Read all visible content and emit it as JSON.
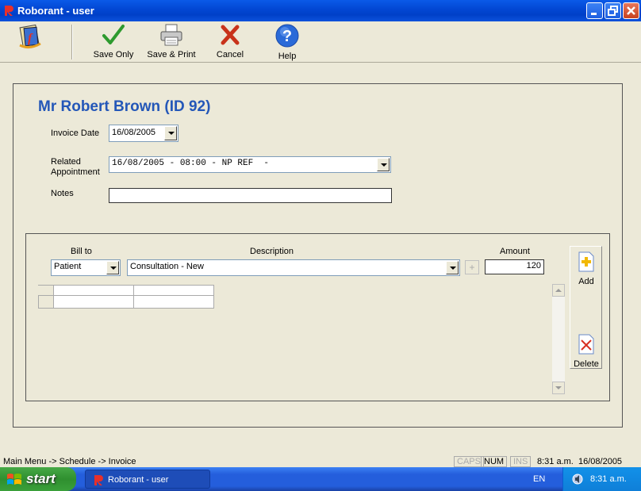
{
  "window": {
    "title": "Roborant - user"
  },
  "toolbar": {
    "save_only": "Save Only",
    "save_print": "Save & Print",
    "cancel": "Cancel",
    "help": "Help"
  },
  "form": {
    "patient_name": "Mr Robert Brown (ID 92)",
    "invoice_date_label": "Invoice Date",
    "invoice_date_value": "16/08/2005",
    "related_label_1": "Related",
    "related_label_2": "Appointment",
    "related_value": "16/08/2005 - 08:00 - NP REF  -",
    "notes_label": "Notes",
    "notes_value": ""
  },
  "line": {
    "bill_to_label": "Bill to",
    "bill_to_value": "Patient",
    "description_label": "Description",
    "description_value": "Consultation - New",
    "amount_label": "Amount",
    "amount_value": "120",
    "plus": "+"
  },
  "side": {
    "add": "Add",
    "delete": "Delete"
  },
  "status": {
    "breadcrumb": "Main Menu -> Schedule -> Invoice",
    "caps": "CAPS",
    "num": "NUM",
    "ins": "INS",
    "time": "8:31 a.m.",
    "date": "16/08/2005"
  },
  "taskbar": {
    "start": "start",
    "task": "Roborant - user",
    "lang": "EN",
    "clock": "8:31 a.m."
  },
  "colors": {
    "title_blue": "#0A5AE8",
    "name_blue": "#2457B8",
    "start_green": "#3AA03A"
  }
}
